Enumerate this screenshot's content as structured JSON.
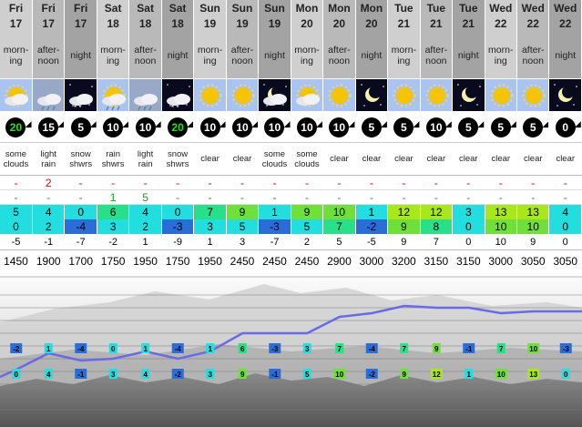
{
  "columns": [
    {
      "day": "Fri",
      "date": "17",
      "tod": "morn-ing",
      "icon": "sun-cloud-icon",
      "wind": "20",
      "wind_green": true,
      "summary": "some clouds",
      "rain": "-",
      "snow": "-",
      "tmax": "5",
      "tmin": "0",
      "feel": "-5",
      "fl": "1450",
      "hd": "a"
    },
    {
      "day": "Fri",
      "date": "17",
      "tod": "after-noon",
      "icon": "light-rain-icon",
      "wind": "15",
      "wind_green": false,
      "summary": "light rain",
      "rain": "2",
      "snow": "-",
      "tmax": "4",
      "tmin": "2",
      "feel": "-1",
      "fl": "1900",
      "hd": "b"
    },
    {
      "day": "Fri",
      "date": "17",
      "tod": "night",
      "icon": "night-snow-icon",
      "wind": "5",
      "wind_green": false,
      "summary": "snow shwrs",
      "rain": "-",
      "snow": "-",
      "tmax": "0",
      "tmin": "-4",
      "feel": "-7",
      "fl": "1700",
      "hd": "n"
    },
    {
      "day": "Sat",
      "date": "18",
      "tod": "morn-ing",
      "icon": "rain-showers-icon",
      "wind": "10",
      "wind_green": false,
      "summary": "rain shwrs",
      "rain": "-",
      "snow": "1",
      "tmax": "6",
      "tmin": "3",
      "feel": "-2",
      "fl": "1750",
      "hd": "a"
    },
    {
      "day": "Sat",
      "date": "18",
      "tod": "after-noon",
      "icon": "light-rain-icon",
      "wind": "10",
      "wind_green": false,
      "summary": "light rain",
      "rain": "-",
      "snow": "5",
      "tmax": "4",
      "tmin": "2",
      "feel": "1",
      "fl": "1950",
      "hd": "b"
    },
    {
      "day": "Sat",
      "date": "18",
      "tod": "night",
      "icon": "night-snow-icon",
      "wind": "20",
      "wind_green": true,
      "summary": "snow shwrs",
      "rain": "-",
      "snow": "-",
      "tmax": "0",
      "tmin": "-3",
      "feel": "-9",
      "fl": "1750",
      "hd": "n"
    },
    {
      "day": "Sun",
      "date": "19",
      "tod": "morn-ing",
      "icon": "sun-icon",
      "wind": "10",
      "wind_green": false,
      "summary": "clear",
      "rain": "-",
      "snow": "-",
      "tmax": "7",
      "tmin": "3",
      "feel": "1",
      "fl": "1950",
      "hd": "a"
    },
    {
      "day": "Sun",
      "date": "19",
      "tod": "after-noon",
      "icon": "sun-icon",
      "wind": "10",
      "wind_green": false,
      "summary": "clear",
      "rain": "-",
      "snow": "-",
      "tmax": "9",
      "tmin": "5",
      "feel": "3",
      "fl": "2450",
      "hd": "b"
    },
    {
      "day": "Sun",
      "date": "19",
      "tod": "night",
      "icon": "night-cloud-icon",
      "wind": "10",
      "wind_green": false,
      "summary": "some clouds",
      "rain": "-",
      "snow": "-",
      "tmax": "1",
      "tmin": "-3",
      "feel": "-7",
      "fl": "2450",
      "hd": "n"
    },
    {
      "day": "Mon",
      "date": "20",
      "tod": "morn-ing",
      "icon": "sun-cloud-icon",
      "wind": "10",
      "wind_green": false,
      "summary": "some clouds",
      "rain": "-",
      "snow": "-",
      "tmax": "9",
      "tmin": "5",
      "feel": "2",
      "fl": "2450",
      "hd": "a"
    },
    {
      "day": "Mon",
      "date": "20",
      "tod": "after-noon",
      "icon": "sun-icon",
      "wind": "10",
      "wind_green": false,
      "summary": "clear",
      "rain": "-",
      "snow": "-",
      "tmax": "10",
      "tmin": "7",
      "feel": "5",
      "fl": "2900",
      "hd": "b"
    },
    {
      "day": "Mon",
      "date": "20",
      "tod": "night",
      "icon": "moon-icon",
      "wind": "5",
      "wind_green": false,
      "summary": "clear",
      "rain": "-",
      "snow": "-",
      "tmax": "1",
      "tmin": "-2",
      "feel": "-5",
      "fl": "3000",
      "hd": "n"
    },
    {
      "day": "Tue",
      "date": "21",
      "tod": "morn-ing",
      "icon": "sun-icon",
      "wind": "5",
      "wind_green": false,
      "summary": "clear",
      "rain": "-",
      "snow": "-",
      "tmax": "12",
      "tmin": "9",
      "feel": "9",
      "fl": "3200",
      "hd": "a"
    },
    {
      "day": "Tue",
      "date": "21",
      "tod": "after-noon",
      "icon": "sun-icon",
      "wind": "10",
      "wind_green": false,
      "summary": "clear",
      "rain": "-",
      "snow": "-",
      "tmax": "12",
      "tmin": "8",
      "feel": "7",
      "fl": "3150",
      "hd": "b"
    },
    {
      "day": "Tue",
      "date": "21",
      "tod": "night",
      "icon": "moon-icon",
      "wind": "5",
      "wind_green": false,
      "summary": "clear",
      "rain": "-",
      "snow": "-",
      "tmax": "3",
      "tmin": "0",
      "feel": "0",
      "fl": "3150",
      "hd": "n"
    },
    {
      "day": "Wed",
      "date": "22",
      "tod": "morn-ing",
      "icon": "sun-icon",
      "wind": "5",
      "wind_green": false,
      "summary": "clear",
      "rain": "-",
      "snow": "-",
      "tmax": "13",
      "tmin": "10",
      "feel": "10",
      "fl": "3000",
      "hd": "a"
    },
    {
      "day": "Wed",
      "date": "22",
      "tod": "after-noon",
      "icon": "sun-icon",
      "wind": "5",
      "wind_green": false,
      "summary": "clear",
      "rain": "-",
      "snow": "-",
      "tmax": "13",
      "tmin": "10",
      "feel": "9",
      "fl": "3050",
      "hd": "b"
    },
    {
      "day": "Wed",
      "date": "22",
      "tod": "night",
      "icon": "moon-icon",
      "wind": "0",
      "wind_green": false,
      "summary": "clear",
      "rain": "-",
      "snow": "-",
      "tmax": "4",
      "tmin": "0",
      "feel": "0",
      "fl": "3050",
      "hd": "n"
    }
  ],
  "chart_data": {
    "type": "line",
    "freezing_level": [
      1450,
      1900,
      1700,
      1750,
      1950,
      1750,
      1950,
      2450,
      2450,
      2450,
      2900,
      3000,
      3200,
      3150,
      3150,
      3000,
      3050,
      3050
    ],
    "top_labels": [
      "-2",
      "1",
      "-4",
      "0",
      "1",
      "-4",
      "1",
      "6",
      "-3",
      "3",
      "7",
      "-4",
      "7",
      "9",
      "-1",
      "7",
      "10",
      "-3"
    ],
    "bottom_labels": [
      "0",
      "4",
      "-1",
      "3",
      "4",
      "-2",
      "3",
      "9",
      "-1",
      "5",
      "10",
      "-2",
      "9",
      "12",
      "1",
      "10",
      "13",
      "0"
    ]
  },
  "colors": {
    "rain": "#dd0000",
    "snow": "#1a9a1a",
    "header_a": "#cfcfcf",
    "header_b": "#b9b9b9",
    "header_n": "#a3a3a3",
    "line": "#6a6ae8",
    "t_neg": "#2a6cd8",
    "t_cold": "#22dede",
    "t_mild": "#28e08a",
    "t_warm": "#6fe03a",
    "t_hot": "#a8e81a"
  }
}
